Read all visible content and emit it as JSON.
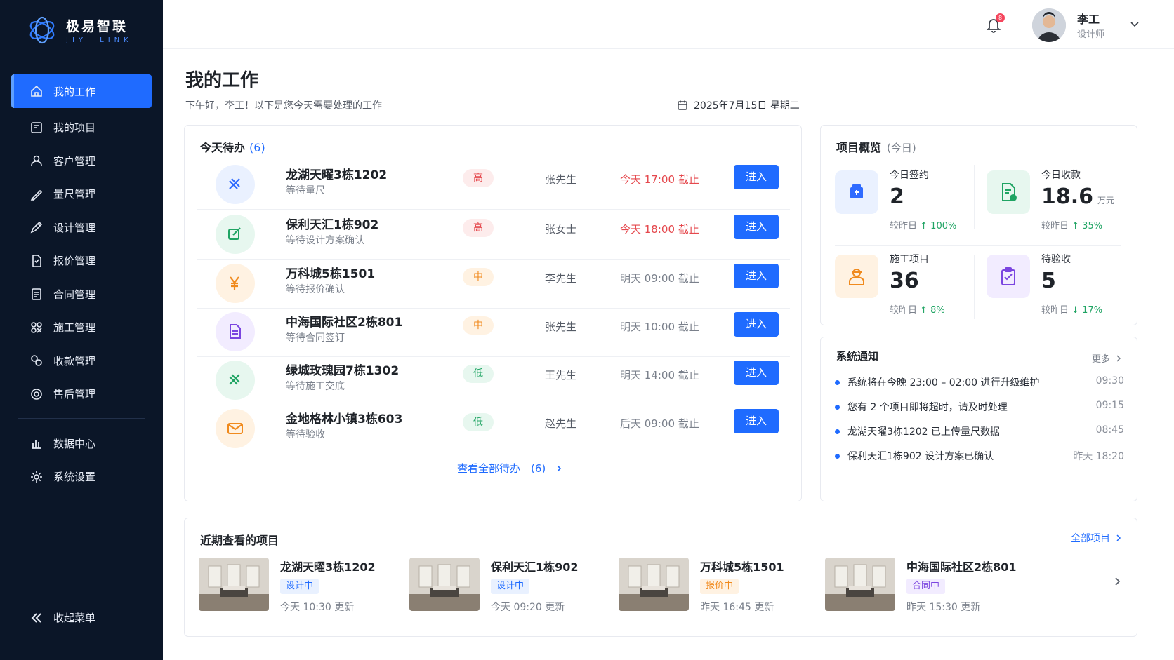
{
  "brand": {
    "name": "极易智联",
    "sub": "JIYI LINK"
  },
  "sidebar": {
    "items": [
      {
        "label": "我的工作",
        "icon": "home-icon",
        "active": true
      },
      {
        "label": "我的项目",
        "icon": "project-icon"
      },
      {
        "label": "客户管理",
        "icon": "user-icon"
      },
      {
        "label": "量尺管理",
        "icon": "ruler-icon"
      },
      {
        "label": "设计管理",
        "icon": "pen-icon"
      },
      {
        "label": "报价管理",
        "icon": "quote-icon"
      },
      {
        "label": "合同管理",
        "icon": "contract-icon"
      },
      {
        "label": "施工管理",
        "icon": "construction-icon"
      },
      {
        "label": "收款管理",
        "icon": "payment-icon"
      },
      {
        "label": "售后管理",
        "icon": "aftersale-icon"
      }
    ],
    "items2": [
      {
        "label": "数据中心",
        "icon": "chart-icon"
      },
      {
        "label": "系统设置",
        "icon": "gear-icon"
      }
    ],
    "collapse_label": "收起菜单"
  },
  "header": {
    "notify_count": "8",
    "user_name": "李工",
    "user_role": "设计师"
  },
  "page": {
    "title": "我的工作",
    "greeting": "下午好，李工！以下是您今天需要处理的工作",
    "date": "2025年7月15日 星期二"
  },
  "todo": {
    "title": "今天待办",
    "count": "(6)",
    "enter_label": "进入",
    "view_all": "查看全部待办　(6)",
    "rows": [
      {
        "name": "龙湖天曜3栋1202",
        "status": "等待量尺",
        "priority": "高",
        "level": "high",
        "person": "张先生",
        "due": "今天 17:00 截止",
        "urgent": true,
        "color": "#2f6bff",
        "bg": "#eaf1ff"
      },
      {
        "name": "保利天汇1栋902",
        "status": "等待设计方案确认",
        "priority": "高",
        "level": "high",
        "person": "张女士",
        "due": "今天 18:00 截止",
        "urgent": true,
        "color": "#1fa463",
        "bg": "#e7f7ef"
      },
      {
        "name": "万科城5栋1501",
        "status": "等待报价确认",
        "priority": "中",
        "level": "mid",
        "person": "李先生",
        "due": "明天 09:00 截止",
        "urgent": false,
        "color": "#f08a1d",
        "bg": "#fff2e2"
      },
      {
        "name": "中海国际社区2栋801",
        "status": "等待合同签订",
        "priority": "中",
        "level": "mid",
        "person": "张先生",
        "due": "明天 10:00 截止",
        "urgent": false,
        "color": "#7b45e0",
        "bg": "#f2ecff"
      },
      {
        "name": "绿城玫瑰园7栋1302",
        "status": "等待施工交底",
        "priority": "低",
        "level": "low",
        "person": "王先生",
        "due": "明天 14:00 截止",
        "urgent": false,
        "color": "#1fa463",
        "bg": "#e7f7ef"
      },
      {
        "name": "金地格林小镇3栋603",
        "status": "等待验收",
        "priority": "低",
        "level": "low",
        "person": "赵先生",
        "due": "后天 09:00 截止",
        "urgent": false,
        "color": "#f08a1d",
        "bg": "#fff2e2"
      }
    ]
  },
  "overview": {
    "title": "项目概览",
    "sub": "(今日)",
    "stats": [
      {
        "label": "今日签约",
        "value": "2",
        "unit": "",
        "cmp_prefix": "较昨日",
        "cmp": "↑ 100%",
        "color": "#2f6bff",
        "bg": "#eaf1ff"
      },
      {
        "label": "今日收款",
        "value": "18.6",
        "unit": "万元",
        "cmp_prefix": "较昨日",
        "cmp": "↑ 35%",
        "color": "#1fa463",
        "bg": "#e7f7ef"
      },
      {
        "label": "施工项目",
        "value": "36",
        "unit": "",
        "cmp_prefix": "较昨日",
        "cmp": "↑ 8%",
        "color": "#f08a1d",
        "bg": "#fff2e2"
      },
      {
        "label": "待验收",
        "value": "5",
        "unit": "",
        "cmp_prefix": "较昨日",
        "cmp": "↓ 17%",
        "color": "#7b45e0",
        "bg": "#f2ecff"
      }
    ]
  },
  "notice": {
    "title": "系统通知",
    "more": "更多",
    "items": [
      {
        "text": "系统将在今晚 23:00 – 02:00 进行升级维护",
        "time": "09:30"
      },
      {
        "text": "您有 2 个项目即将超时，请及时处理",
        "time": "09:15"
      },
      {
        "text": "龙湖天曜3栋1202 已上传量尺数据",
        "time": "08:45"
      },
      {
        "text": "保利天汇1栋902 设计方案已确认",
        "time": "昨天 18:20"
      }
    ]
  },
  "recent": {
    "title": "近期查看的项目",
    "all_label": "全部项目",
    "items": [
      {
        "name": "龙湖天曜3栋1202",
        "tag": "设计中",
        "tag_style": "blue",
        "time": "今天 10:30 更新"
      },
      {
        "name": "保利天汇1栋902",
        "tag": "设计中",
        "tag_style": "blue",
        "time": "今天 09:20 更新"
      },
      {
        "name": "万科城5栋1501",
        "tag": "报价中",
        "tag_style": "orange",
        "time": "昨天 16:45 更新"
      },
      {
        "name": "中海国际社区2栋801",
        "tag": "合同中",
        "tag_style": "purple",
        "time": "昨天 15:30 更新"
      }
    ]
  }
}
